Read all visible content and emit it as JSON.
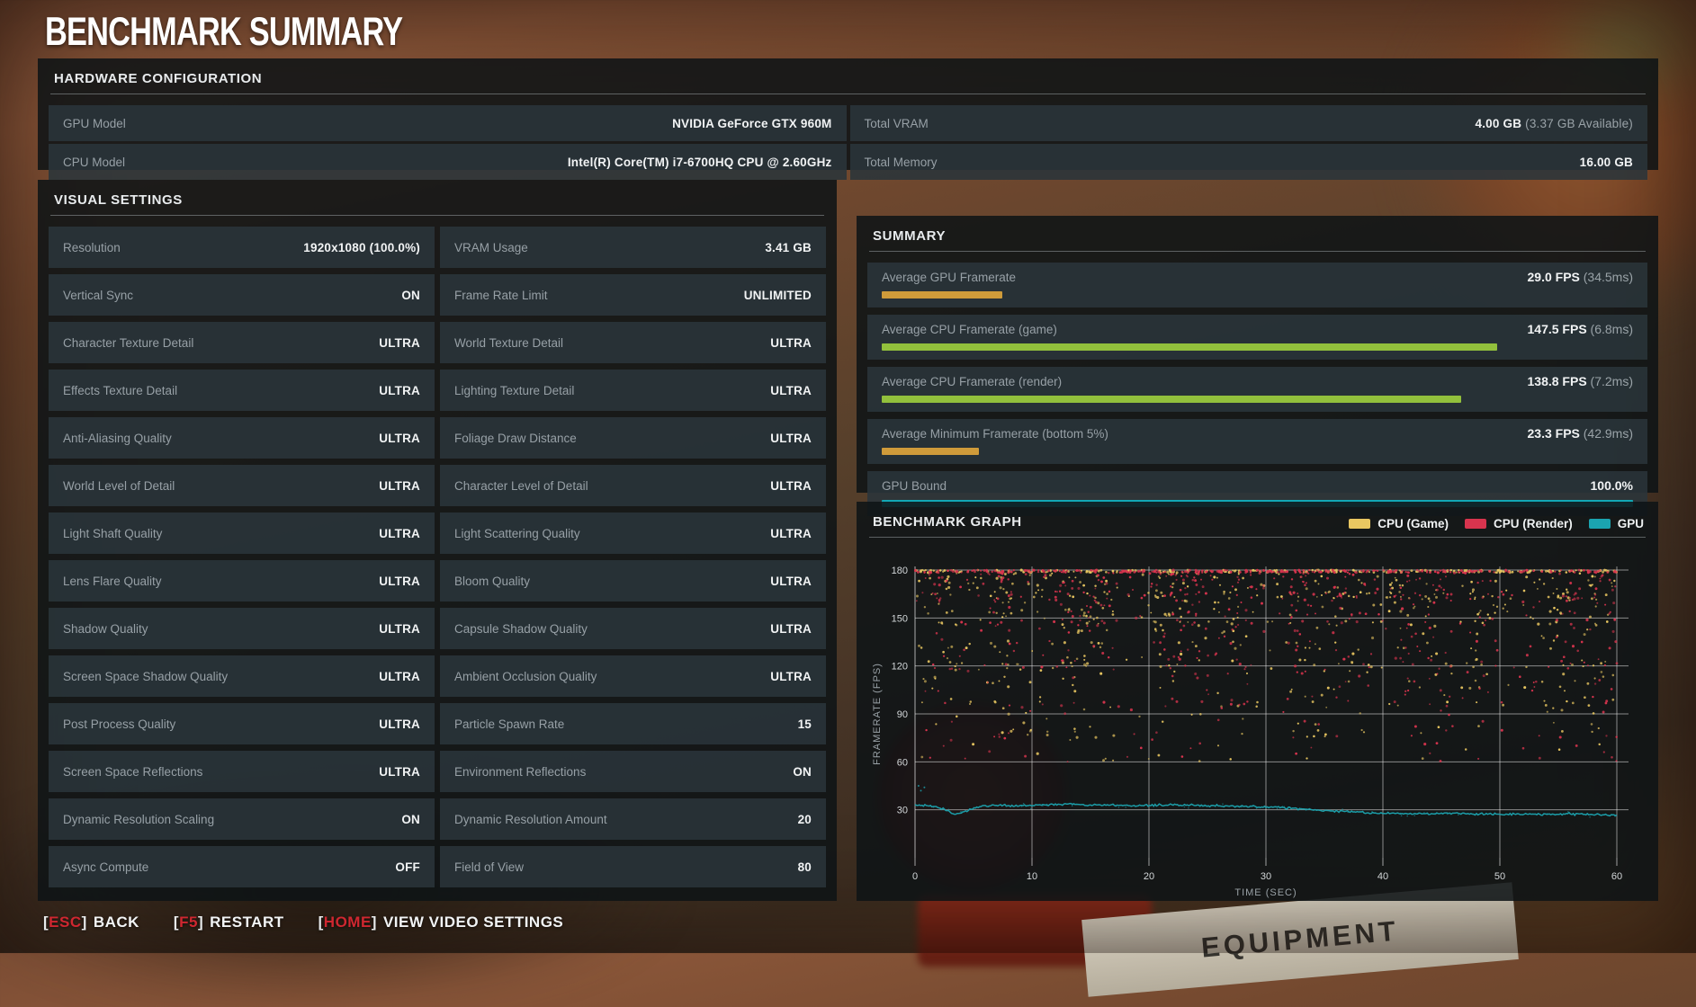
{
  "title": "BENCHMARK SUMMARY",
  "colors": {
    "orange": "#cf9b3a",
    "green": "#92c03c",
    "teal": "#12a8b6",
    "legend_yellow": "#e9c761",
    "legend_red": "#d8344e",
    "legend_teal": "#1ba4b0",
    "key_red": "#cf2730",
    "row_bg": "#2a343a",
    "panel_bg": "#0e1316"
  },
  "hardware": {
    "header": "HARDWARE CONFIGURATION",
    "rows": [
      {
        "label": "GPU Model",
        "value": "NVIDIA GeForce GTX 960M",
        "sub": ""
      },
      {
        "label": "Total VRAM",
        "value": "4.00 GB",
        "sub": "(3.37 GB Available)"
      },
      {
        "label": "CPU Model",
        "value": "Intel(R) Core(TM) i7-6700HQ CPU @ 2.60GHz",
        "sub": ""
      },
      {
        "label": "Total Memory",
        "value": "16.00 GB",
        "sub": ""
      }
    ]
  },
  "visual_settings": {
    "header": "VISUAL SETTINGS",
    "left": [
      {
        "label": "Resolution",
        "value": "1920x1080 (100.0%)"
      },
      {
        "label": "Vertical Sync",
        "value": "ON"
      },
      {
        "label": "Character Texture Detail",
        "value": "ULTRA"
      },
      {
        "label": "Effects Texture Detail",
        "value": "ULTRA"
      },
      {
        "label": "Anti-Aliasing Quality",
        "value": "ULTRA"
      },
      {
        "label": "World Level of Detail",
        "value": "ULTRA"
      },
      {
        "label": "Light Shaft Quality",
        "value": "ULTRA"
      },
      {
        "label": "Lens Flare Quality",
        "value": "ULTRA"
      },
      {
        "label": "Shadow Quality",
        "value": "ULTRA"
      },
      {
        "label": "Screen Space Shadow Quality",
        "value": "ULTRA"
      },
      {
        "label": "Post Process Quality",
        "value": "ULTRA"
      },
      {
        "label": "Screen Space Reflections",
        "value": "ULTRA"
      },
      {
        "label": "Dynamic Resolution Scaling",
        "value": "ON"
      },
      {
        "label": "Async Compute",
        "value": "OFF"
      }
    ],
    "right": [
      {
        "label": "VRAM Usage",
        "value": "3.41 GB"
      },
      {
        "label": "Frame Rate Limit",
        "value": "UNLIMITED"
      },
      {
        "label": "World Texture Detail",
        "value": "ULTRA"
      },
      {
        "label": "Lighting Texture Detail",
        "value": "ULTRA"
      },
      {
        "label": "Foliage Draw Distance",
        "value": "ULTRA"
      },
      {
        "label": "Character Level of Detail",
        "value": "ULTRA"
      },
      {
        "label": "Light Scattering Quality",
        "value": "ULTRA"
      },
      {
        "label": "Bloom Quality",
        "value": "ULTRA"
      },
      {
        "label": "Capsule Shadow Quality",
        "value": "ULTRA"
      },
      {
        "label": "Ambient Occlusion Quality",
        "value": "ULTRA"
      },
      {
        "label": "Particle Spawn Rate",
        "value": "15"
      },
      {
        "label": "Environment Reflections",
        "value": "ON"
      },
      {
        "label": "Dynamic Resolution Amount",
        "value": "20"
      },
      {
        "label": "Field of View",
        "value": "80"
      }
    ]
  },
  "summary": {
    "header": "SUMMARY",
    "max_fps": 180,
    "rows": [
      {
        "label": "Average GPU Framerate",
        "value": "29.0 FPS",
        "sub": "(34.5ms)",
        "fps": 29.0,
        "color": "orange"
      },
      {
        "label": "Average CPU Framerate (game)",
        "value": "147.5 FPS",
        "sub": "(6.8ms)",
        "fps": 147.5,
        "color": "green"
      },
      {
        "label": "Average CPU Framerate (render)",
        "value": "138.8 FPS",
        "sub": "(7.2ms)",
        "fps": 138.8,
        "color": "green"
      },
      {
        "label": "Average Minimum Framerate (bottom 5%)",
        "value": "23.3 FPS",
        "sub": "(42.9ms)",
        "fps": 23.3,
        "color": "orange"
      },
      {
        "label": "GPU Bound",
        "value": "100.0%",
        "sub": "",
        "percent": 100.0,
        "color": "teal"
      }
    ]
  },
  "graph": {
    "header": "BENCHMARK GRAPH",
    "legend": [
      {
        "label": "CPU (Game)",
        "color": "#e9c761"
      },
      {
        "label": "CPU (Render)",
        "color": "#d8344e"
      },
      {
        "label": "GPU",
        "color": "#1ba4b0"
      }
    ]
  },
  "chart_data": {
    "type": "scatter",
    "title": "BENCHMARK GRAPH",
    "xlabel": "TIME (SEC)",
    "ylabel": "FRAMERATE (FPS)",
    "xlim": [
      0,
      60
    ],
    "ylim": [
      0,
      180
    ],
    "x_ticks": [
      0,
      10,
      20,
      30,
      40,
      50,
      60
    ],
    "y_ticks": [
      30,
      60,
      90,
      120,
      150,
      180
    ],
    "grid": true,
    "legend_position": "top-right",
    "series": [
      {
        "name": "CPU (Game)",
        "type": "scatter",
        "color": "#e9c761",
        "n_points": 600,
        "cap_points": 230,
        "cap_fps": 180,
        "cap_x_split": 43,
        "cluster_fraction": 0.45,
        "clusters_x": [
          3,
          8,
          13,
          15,
          21,
          23,
          27,
          34,
          36,
          41,
          44,
          48,
          55,
          58
        ],
        "bands": [
          {
            "weight": 0.28,
            "y": [
              162,
              179
            ]
          },
          {
            "weight": 0.24,
            "y": [
              145,
              166
            ]
          },
          {
            "weight": 0.2,
            "y": [
              118,
              148
            ]
          },
          {
            "weight": 0.14,
            "y": [
              95,
              122
            ]
          },
          {
            "weight": 0.09,
            "y": [
              75,
              98
            ]
          },
          {
            "weight": 0.05,
            "y": [
              60,
              80
            ]
          }
        ]
      },
      {
        "name": "CPU (Render)",
        "type": "scatter",
        "color": "#d8344e",
        "n_points": 600,
        "cap_points": 280,
        "cap_fps": 180,
        "cap_x_split": 43,
        "cluster_fraction": 0.45,
        "clusters_x": [
          2,
          7,
          13,
          16,
          22,
          24,
          28,
          33,
          37,
          42,
          45,
          49,
          56,
          59
        ],
        "bands": [
          {
            "weight": 0.34,
            "y": [
              162,
              179
            ]
          },
          {
            "weight": 0.24,
            "y": [
              145,
              166
            ]
          },
          {
            "weight": 0.18,
            "y": [
              118,
              148
            ]
          },
          {
            "weight": 0.12,
            "y": [
              95,
              122
            ]
          },
          {
            "weight": 0.08,
            "y": [
              75,
              98
            ]
          },
          {
            "weight": 0.04,
            "y": [
              60,
              80
            ]
          }
        ]
      },
      {
        "name": "GPU",
        "type": "line",
        "color": "#1ba4b0",
        "noise": 0.55,
        "points": [
          [
            0,
            33
          ],
          [
            1.5,
            32.5
          ],
          [
            2.5,
            30.5
          ],
          [
            3,
            28.5
          ],
          [
            3.5,
            27
          ],
          [
            4.5,
            29.5
          ],
          [
            5,
            31
          ],
          [
            6,
            32.5
          ],
          [
            7,
            33
          ],
          [
            9,
            32.5
          ],
          [
            11,
            33
          ],
          [
            13,
            33.5
          ],
          [
            15,
            33
          ],
          [
            17,
            33
          ],
          [
            19,
            32.5
          ],
          [
            21,
            33
          ],
          [
            23,
            33
          ],
          [
            25,
            32.5
          ],
          [
            27,
            32.5
          ],
          [
            29,
            32
          ],
          [
            31,
            31.5
          ],
          [
            32,
            31
          ],
          [
            33,
            30.5
          ],
          [
            34,
            30
          ],
          [
            35,
            29.5
          ],
          [
            36,
            29
          ],
          [
            37,
            29
          ],
          [
            38,
            28.5
          ],
          [
            39,
            28
          ],
          [
            40,
            28
          ],
          [
            42,
            27.5
          ],
          [
            44,
            27.5
          ],
          [
            46,
            28
          ],
          [
            48,
            27.5
          ],
          [
            50,
            27
          ],
          [
            52,
            27.5
          ],
          [
            54,
            27
          ],
          [
            56,
            27.5
          ],
          [
            58,
            27
          ],
          [
            60,
            26.5
          ]
        ]
      }
    ]
  },
  "footer": {
    "items": [
      {
        "key": "ESC",
        "label": "BACK"
      },
      {
        "key": "F5",
        "label": "RESTART"
      },
      {
        "key": "HOME",
        "label": "VIEW VIDEO SETTINGS"
      }
    ]
  }
}
